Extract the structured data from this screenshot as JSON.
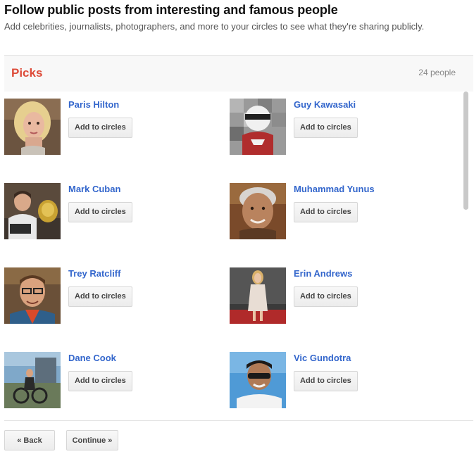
{
  "header": {
    "title": "Follow public posts from interesting and famous people",
    "subtitle": "Add celebrities, journalists, photographers, and more to your circles to see what they're sharing publicly."
  },
  "panel": {
    "title": "Picks",
    "count": "24 people"
  },
  "people": [
    {
      "name": "Paris Hilton",
      "button": "Add to circles"
    },
    {
      "name": "Guy Kawasaki",
      "button": "Add to circles"
    },
    {
      "name": "Mark Cuban",
      "button": "Add to circles"
    },
    {
      "name": "Muhammad Yunus",
      "button": "Add to circles"
    },
    {
      "name": "Trey Ratcliff",
      "button": "Add to circles"
    },
    {
      "name": "Erin Andrews",
      "button": "Add to circles"
    },
    {
      "name": "Dane Cook",
      "button": "Add to circles"
    },
    {
      "name": "Vic Gundotra",
      "button": "Add to circles"
    }
  ],
  "footer": {
    "back_label": "« Back",
    "continue_label": "Continue »"
  },
  "colors": {
    "picks_red": "#dd4b39",
    "link_blue": "#3366cc"
  }
}
